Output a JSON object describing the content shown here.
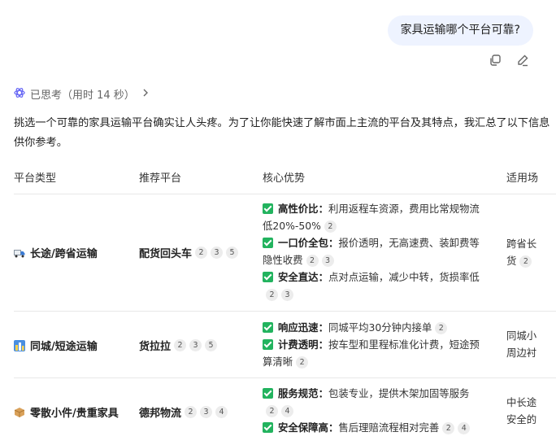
{
  "user_message": "家具运输哪个平台可靠?",
  "thought_label": "已思考（用时 14 秒）",
  "intro_text": "挑选一个可靠的家具运输平台确实让人头疼。为了让你能快速了解市面上主流的平台及其特点，我汇总了以下信息供你参考。",
  "table": {
    "headers": [
      "平台类型",
      "推荐平台",
      "核心优势",
      "适用场"
    ],
    "rows": [
      {
        "category": "长途/跨省运输",
        "category_icon": "truck-icon",
        "platform": "配货回头车",
        "platform_cites": [
          "2",
          "3",
          "5"
        ],
        "advantages": [
          {
            "title": "高性价比",
            "desc": "利用返程车资源，费用比常规物流低20%-50%",
            "cites": [
              "2"
            ]
          },
          {
            "title": "一口价全包",
            "desc": "报价透明，无高速费、装卸费等隐性收费",
            "cites": [
              "2",
              "3"
            ]
          },
          {
            "title": "安全直达",
            "desc": "点对点运输，减少中转，货损率低",
            "cites": [
              "2",
              "3"
            ]
          }
        ],
        "scenario_line1": "跨省长",
        "scenario_line2": "货",
        "scenario_cites": [
          "2"
        ]
      },
      {
        "category": "同城/短途运输",
        "category_icon": "city-icon",
        "platform": "货拉拉",
        "platform_cites": [
          "2",
          "3",
          "5"
        ],
        "advantages": [
          {
            "title": "响应迅速",
            "desc": "同城平均30分钟内接单",
            "cites": [
              "2"
            ]
          },
          {
            "title": "计费透明",
            "desc": "按车型和里程标准化计费，短途预算清晰",
            "cites": [
              "2"
            ]
          }
        ],
        "scenario_line1": "同城小",
        "scenario_line2": "周边衬",
        "scenario_cites": []
      },
      {
        "category": "零散小件/贵重家具",
        "category_icon": "package-icon",
        "platform": "德邦物流",
        "platform_cites": [
          "2",
          "3",
          "4"
        ],
        "advantages": [
          {
            "title": "服务规范",
            "desc": "包装专业，提供木架加固等服务",
            "cites": [
              "2",
              "4"
            ]
          },
          {
            "title": "安全保障高",
            "desc": "售后理赔流程相对完善",
            "cites": [
              "2",
              "4"
            ]
          }
        ],
        "scenario_line1": "中长途",
        "scenario_line2": "安全的",
        "scenario_cites": []
      }
    ]
  },
  "colors": {
    "check_green": "#22b35e",
    "bubble_bg": "#eef3ff",
    "thought_icon": "#6b6bf5"
  }
}
